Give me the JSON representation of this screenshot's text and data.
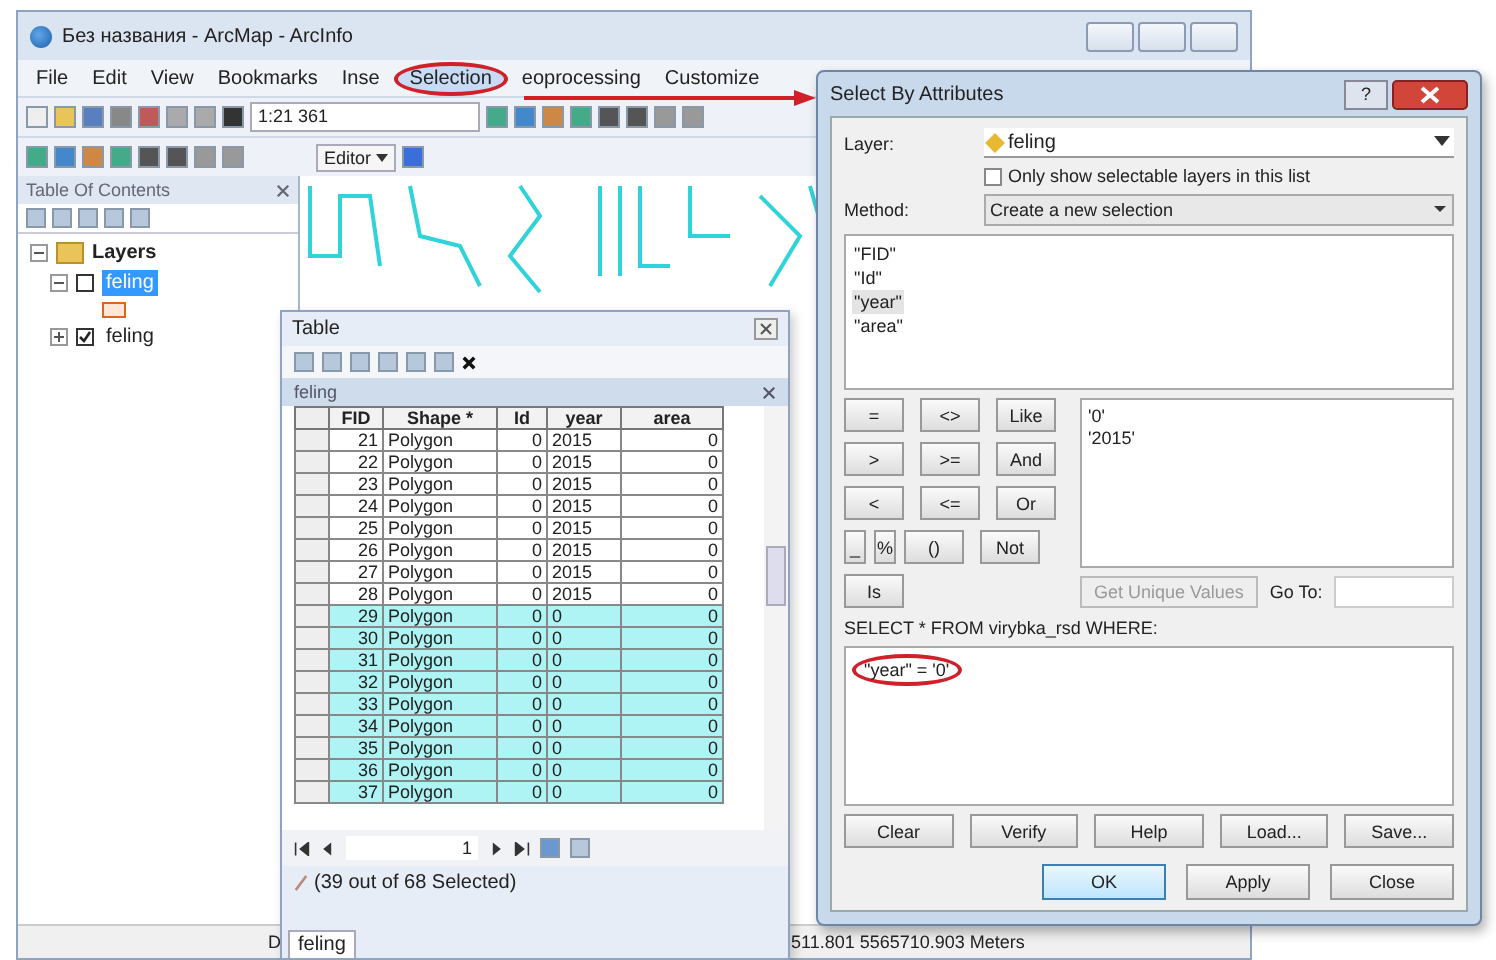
{
  "window": {
    "title": "Без названия - ArcMap - ArcInfo"
  },
  "menu": [
    {
      "label": "File",
      "selected": false,
      "circled": false
    },
    {
      "label": "Edit",
      "selected": false,
      "circled": false
    },
    {
      "label": "View",
      "selected": false,
      "circled": false
    },
    {
      "label": "Bookmarks",
      "selected": false,
      "circled": false
    },
    {
      "label": "Inse",
      "selected": false,
      "circled": false
    },
    {
      "label": "Selection",
      "selected": true,
      "circled": true
    },
    {
      "label": "eoprocessing",
      "selected": false,
      "circled": false
    },
    {
      "label": "Customize",
      "selected": false,
      "circled": false
    }
  ],
  "arrow_to_dialog": true,
  "toolbar": {
    "scale": "1:21 361",
    "editor": "Editor"
  },
  "toc": {
    "title": "Table Of Contents",
    "root": "Layers",
    "layers": [
      {
        "name": "feling",
        "checked": false,
        "selected": true,
        "expanded": true
      },
      {
        "name": "feling",
        "checked": true,
        "selected": false,
        "expanded": false
      }
    ]
  },
  "table": {
    "title": "Table",
    "layer_title": "feling",
    "columns": [
      "FID",
      "Shape *",
      "Id",
      "year",
      "area"
    ],
    "rows": [
      {
        "cells": [
          "21",
          "Polygon",
          "0",
          "2015",
          "0"
        ],
        "selected": false
      },
      {
        "cells": [
          "22",
          "Polygon",
          "0",
          "2015",
          "0"
        ],
        "selected": false
      },
      {
        "cells": [
          "23",
          "Polygon",
          "0",
          "2015",
          "0"
        ],
        "selected": false
      },
      {
        "cells": [
          "24",
          "Polygon",
          "0",
          "2015",
          "0"
        ],
        "selected": false
      },
      {
        "cells": [
          "25",
          "Polygon",
          "0",
          "2015",
          "0"
        ],
        "selected": false
      },
      {
        "cells": [
          "26",
          "Polygon",
          "0",
          "2015",
          "0"
        ],
        "selected": false
      },
      {
        "cells": [
          "27",
          "Polygon",
          "0",
          "2015",
          "0"
        ],
        "selected": false
      },
      {
        "cells": [
          "28",
          "Polygon",
          "0",
          "2015",
          "0"
        ],
        "selected": false
      },
      {
        "cells": [
          "29",
          "Polygon",
          "0",
          "0",
          "0"
        ],
        "selected": true
      },
      {
        "cells": [
          "30",
          "Polygon",
          "0",
          "0",
          "0"
        ],
        "selected": true
      },
      {
        "cells": [
          "31",
          "Polygon",
          "0",
          "0",
          "0"
        ],
        "selected": true
      },
      {
        "cells": [
          "32",
          "Polygon",
          "0",
          "0",
          "0"
        ],
        "selected": true
      },
      {
        "cells": [
          "33",
          "Polygon",
          "0",
          "0",
          "0"
        ],
        "selected": true
      },
      {
        "cells": [
          "34",
          "Polygon",
          "0",
          "0",
          "0"
        ],
        "selected": true
      },
      {
        "cells": [
          "35",
          "Polygon",
          "0",
          "0",
          "0"
        ],
        "selected": true
      },
      {
        "cells": [
          "36",
          "Polygon",
          "0",
          "0",
          "0"
        ],
        "selected": true
      },
      {
        "cells": [
          "37",
          "Polygon",
          "0",
          "0",
          "0"
        ],
        "selected": true
      }
    ],
    "page": "1",
    "selection_status": "(39 out of 68 Selected)",
    "tabs": [
      "feling"
    ]
  },
  "status_bar": {
    "left": "D",
    "coordinates": "511.801  5565710.903 Meters"
  },
  "dialog": {
    "title": "Select By Attributes",
    "help_button": "?",
    "layer_label": "Layer:",
    "layer": "feling",
    "only_selectable": {
      "label": "Only show selectable layers in this list",
      "checked": false
    },
    "method_label": "Method:",
    "method": "Create a new selection",
    "fields": [
      {
        "label": "\"FID\"",
        "selected": false
      },
      {
        "label": "\"Id\"",
        "selected": false
      },
      {
        "label": "\"year\"",
        "selected": true
      },
      {
        "label": "\"area\"",
        "selected": false
      }
    ],
    "operators": [
      [
        "=",
        "<>",
        "Like"
      ],
      [
        ">",
        ">=",
        "And"
      ],
      [
        "<",
        "<=",
        "Or"
      ],
      [
        "_",
        "%",
        "()",
        "Not"
      ],
      [
        "Is"
      ]
    ],
    "values": [
      "'0'",
      "'2015'"
    ],
    "unique_values_button": {
      "label": "Get Unique Values",
      "disabled": true
    },
    "goto_label": "Go To:",
    "sql_label": "SELECT * FROM virybka_rsd WHERE:",
    "expression": {
      "text": "\"year\" = '0'",
      "circled": true
    },
    "buttons": [
      "Clear",
      "Verify",
      "Help",
      "Load...",
      "Save..."
    ],
    "footer_buttons": [
      {
        "label": "OK",
        "default": true
      },
      {
        "label": "Apply",
        "default": false
      },
      {
        "label": "Close",
        "default": false
      }
    ]
  }
}
